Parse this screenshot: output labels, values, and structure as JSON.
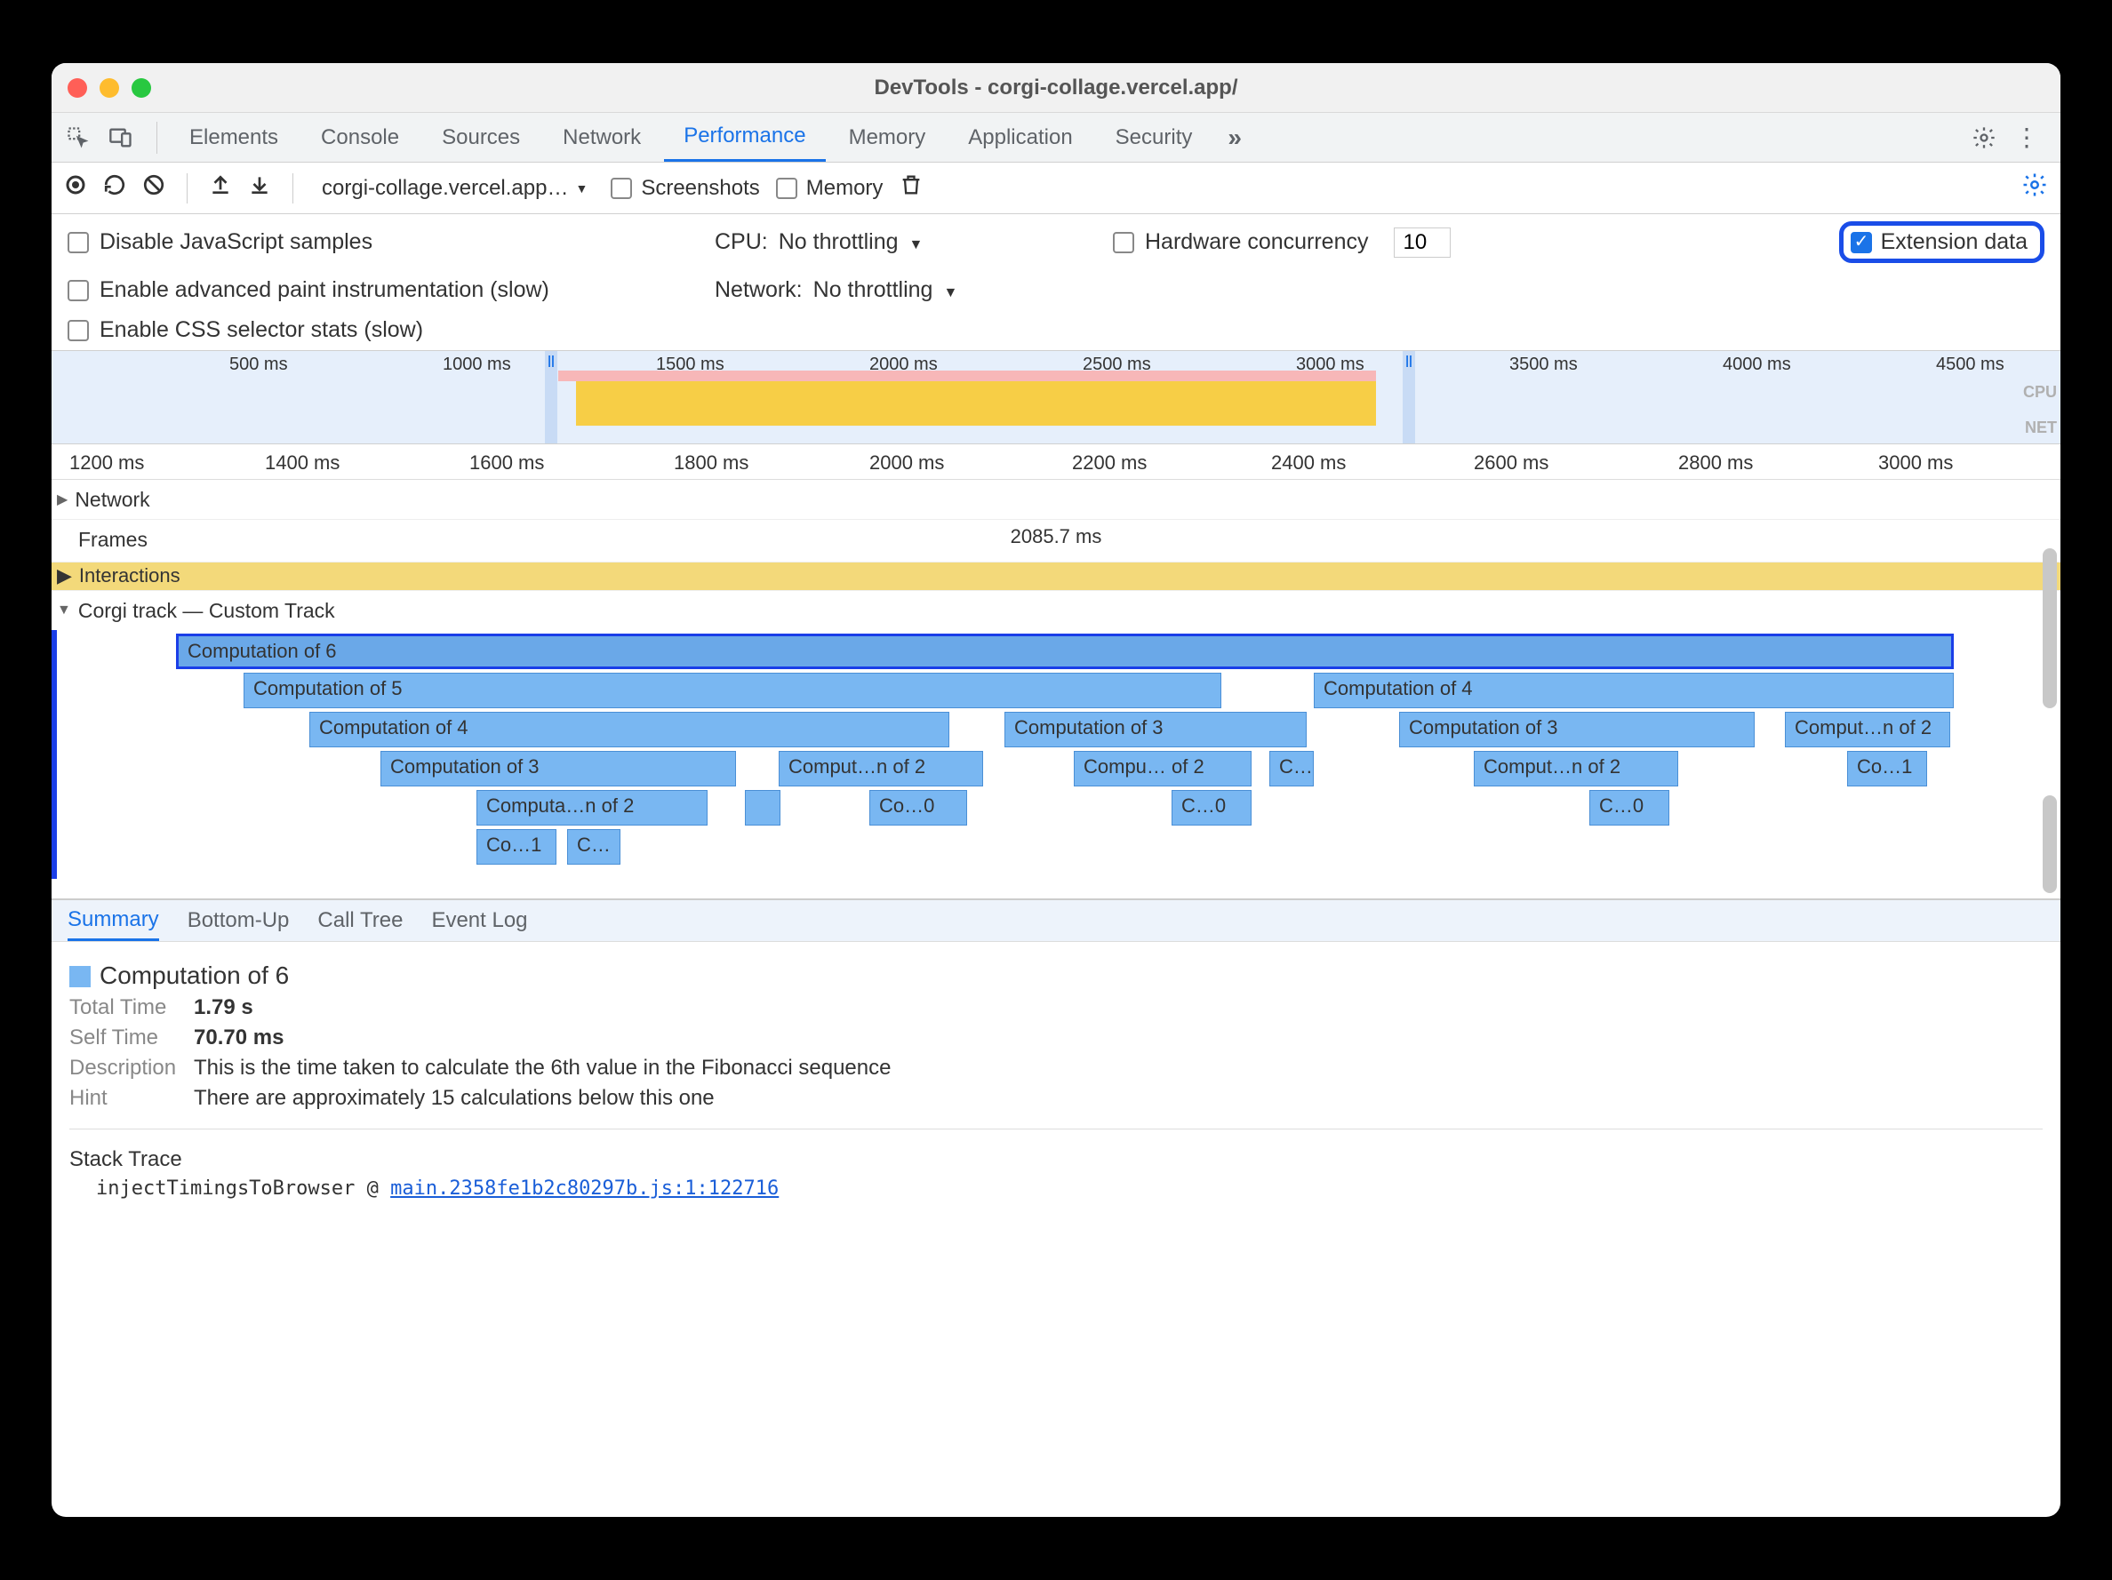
{
  "window": {
    "title": "DevTools - corgi-collage.vercel.app/"
  },
  "nav_tabs": {
    "elements": "Elements",
    "console": "Console",
    "sources": "Sources",
    "network": "Network",
    "performance": "Performance",
    "memory": "Memory",
    "application": "Application",
    "security": "Security",
    "more": "»"
  },
  "toolbar": {
    "target": "corgi-collage.vercel.app…",
    "screenshots": "Screenshots",
    "memory": "Memory"
  },
  "settings": {
    "disable_js_samples": "Disable JavaScript samples",
    "enable_paint": "Enable advanced paint instrumentation (slow)",
    "enable_css_stats": "Enable CSS selector stats (slow)",
    "cpu_label": "CPU:",
    "cpu_value": "No throttling",
    "network_label": "Network:",
    "network_value": "No throttling",
    "hardware_label": "Hardware concurrency",
    "hardware_value": "10",
    "extension_data": "Extension data"
  },
  "overview": {
    "ticks": [
      "500 ms",
      "1000 ms",
      "1500 ms",
      "2000 ms",
      "2500 ms",
      "3000 ms",
      "3500 ms",
      "4000 ms",
      "4500 ms"
    ],
    "cpu_lbl": "CPU",
    "net_lbl": "NET"
  },
  "ruler": {
    "ticks": [
      "1200 ms",
      "1400 ms",
      "1600 ms",
      "1800 ms",
      "2000 ms",
      "2200 ms",
      "2400 ms",
      "2600 ms",
      "2800 ms",
      "3000 ms"
    ]
  },
  "tracks": {
    "network": "Network",
    "frames": "Frames",
    "frames_duration": "2085.7 ms",
    "interactions": "Interactions",
    "custom": "Corgi track — Custom Track"
  },
  "flame": {
    "c6": "Computation of 6",
    "c5": "Computation of 5",
    "c4a": "Computation of 4",
    "c4b": "Computation of 4",
    "c3a": "Computation of 3",
    "c3b": "Computation of 3",
    "c3c": "Computation of 3",
    "c2a": "Comput…n of 2",
    "c2b": "Compu… of 2",
    "c2c": "Comput…n of 2",
    "c2d": "Computa…n of 2",
    "c2e": "Comput…n of 2",
    "c1a": "Co…1",
    "c1b": "Co…1",
    "c0a": "Co…0",
    "c0b": "C…0",
    "c0c": "C…0",
    "cext": "C…",
    "cext2": "C…"
  },
  "detail_tabs": {
    "summary": "Summary",
    "bottom": "Bottom-Up",
    "call": "Call Tree",
    "event": "Event Log"
  },
  "summary": {
    "title": "Computation of 6",
    "total_time_lbl": "Total Time",
    "total_time": "1.79 s",
    "self_time_lbl": "Self Time",
    "self_time": "70.70 ms",
    "description_lbl": "Description",
    "description": "This is the time taken to calculate the 6th value in the Fibonacci sequence",
    "hint_lbl": "Hint",
    "hint": "There are approximately 15 calculations below this one",
    "stack_trace": "Stack Trace",
    "stack_fn": "injectTimingsToBrowser @ ",
    "stack_link": "main.2358fe1b2c80297b.js:1:122716"
  }
}
